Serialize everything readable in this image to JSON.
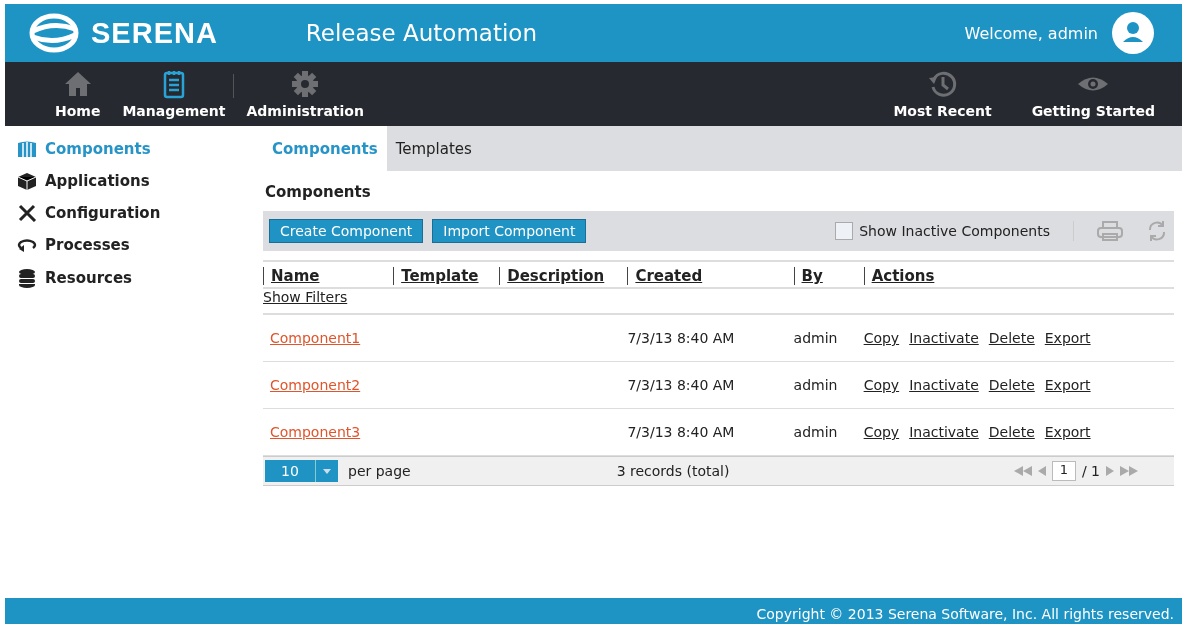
{
  "header": {
    "logo": "SERENA",
    "title": "Release Automation",
    "welcome": "Welcome, admin"
  },
  "nav_left": [
    {
      "label": "Home",
      "selected": false
    },
    {
      "label": "Management",
      "selected": true
    },
    {
      "label": "Administration",
      "selected": false
    }
  ],
  "nav_right": [
    {
      "label": "Most Recent"
    },
    {
      "label": "Getting Started"
    }
  ],
  "sidebar": {
    "items": [
      {
        "label": "Components",
        "selected": true
      },
      {
        "label": "Applications",
        "selected": false
      },
      {
        "label": "Configuration",
        "selected": false
      },
      {
        "label": "Processes",
        "selected": false
      },
      {
        "label": "Resources",
        "selected": false
      }
    ]
  },
  "tabs": [
    {
      "label": "Components",
      "selected": true
    },
    {
      "label": "Templates",
      "selected": false
    }
  ],
  "section_title": "Components",
  "toolbar": {
    "buttons": [
      "Create Component",
      "Import Component"
    ],
    "show_inactive": {
      "label": "Show Inactive Components",
      "checked": false
    }
  },
  "table": {
    "columns": [
      "Name",
      "Template",
      "Description",
      "Created",
      "By",
      "Actions"
    ],
    "show_filters": "Show Filters",
    "rows": [
      {
        "name": "Component1",
        "created": "7/3/13 8:40 AM",
        "by": "admin",
        "actions": [
          "Copy",
          "Inactivate",
          "Delete",
          "Export"
        ]
      },
      {
        "name": "Component2",
        "created": "7/3/13 8:40 AM",
        "by": "admin",
        "actions": [
          "Copy",
          "Inactivate",
          "Delete",
          "Export"
        ]
      },
      {
        "name": "Component3",
        "created": "7/3/13 8:40 AM",
        "by": "admin",
        "actions": [
          "Copy",
          "Inactivate",
          "Delete",
          "Export"
        ]
      }
    ]
  },
  "pager": {
    "page_size": "10",
    "per_page": "per page",
    "total": "3 records (total)",
    "page": "1",
    "of": "/ 1"
  },
  "footer": "Copyright © 2013 Serena Software, Inc. All rights reserved."
}
